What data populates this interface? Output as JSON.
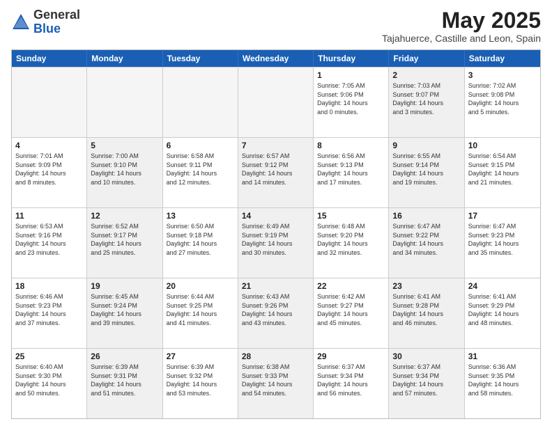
{
  "header": {
    "logo_general": "General",
    "logo_blue": "Blue",
    "month_year": "May 2025",
    "location": "Tajahuerce, Castille and Leon, Spain"
  },
  "days_of_week": [
    "Sunday",
    "Monday",
    "Tuesday",
    "Wednesday",
    "Thursday",
    "Friday",
    "Saturday"
  ],
  "weeks": [
    [
      {
        "day": "",
        "detail": "",
        "empty": true
      },
      {
        "day": "",
        "detail": "",
        "empty": true
      },
      {
        "day": "",
        "detail": "",
        "empty": true
      },
      {
        "day": "",
        "detail": "",
        "empty": true
      },
      {
        "day": "1",
        "detail": "Sunrise: 7:05 AM\nSunset: 9:06 PM\nDaylight: 14 hours\nand 0 minutes.",
        "shaded": false
      },
      {
        "day": "2",
        "detail": "Sunrise: 7:03 AM\nSunset: 9:07 PM\nDaylight: 14 hours\nand 3 minutes.",
        "shaded": true
      },
      {
        "day": "3",
        "detail": "Sunrise: 7:02 AM\nSunset: 9:08 PM\nDaylight: 14 hours\nand 5 minutes.",
        "shaded": false
      }
    ],
    [
      {
        "day": "4",
        "detail": "Sunrise: 7:01 AM\nSunset: 9:09 PM\nDaylight: 14 hours\nand 8 minutes.",
        "shaded": false
      },
      {
        "day": "5",
        "detail": "Sunrise: 7:00 AM\nSunset: 9:10 PM\nDaylight: 14 hours\nand 10 minutes.",
        "shaded": true
      },
      {
        "day": "6",
        "detail": "Sunrise: 6:58 AM\nSunset: 9:11 PM\nDaylight: 14 hours\nand 12 minutes.",
        "shaded": false
      },
      {
        "day": "7",
        "detail": "Sunrise: 6:57 AM\nSunset: 9:12 PM\nDaylight: 14 hours\nand 14 minutes.",
        "shaded": true
      },
      {
        "day": "8",
        "detail": "Sunrise: 6:56 AM\nSunset: 9:13 PM\nDaylight: 14 hours\nand 17 minutes.",
        "shaded": false
      },
      {
        "day": "9",
        "detail": "Sunrise: 6:55 AM\nSunset: 9:14 PM\nDaylight: 14 hours\nand 19 minutes.",
        "shaded": true
      },
      {
        "day": "10",
        "detail": "Sunrise: 6:54 AM\nSunset: 9:15 PM\nDaylight: 14 hours\nand 21 minutes.",
        "shaded": false
      }
    ],
    [
      {
        "day": "11",
        "detail": "Sunrise: 6:53 AM\nSunset: 9:16 PM\nDaylight: 14 hours\nand 23 minutes.",
        "shaded": false
      },
      {
        "day": "12",
        "detail": "Sunrise: 6:52 AM\nSunset: 9:17 PM\nDaylight: 14 hours\nand 25 minutes.",
        "shaded": true
      },
      {
        "day": "13",
        "detail": "Sunrise: 6:50 AM\nSunset: 9:18 PM\nDaylight: 14 hours\nand 27 minutes.",
        "shaded": false
      },
      {
        "day": "14",
        "detail": "Sunrise: 6:49 AM\nSunset: 9:19 PM\nDaylight: 14 hours\nand 30 minutes.",
        "shaded": true
      },
      {
        "day": "15",
        "detail": "Sunrise: 6:48 AM\nSunset: 9:20 PM\nDaylight: 14 hours\nand 32 minutes.",
        "shaded": false
      },
      {
        "day": "16",
        "detail": "Sunrise: 6:47 AM\nSunset: 9:22 PM\nDaylight: 14 hours\nand 34 minutes.",
        "shaded": true
      },
      {
        "day": "17",
        "detail": "Sunrise: 6:47 AM\nSunset: 9:23 PM\nDaylight: 14 hours\nand 35 minutes.",
        "shaded": false
      }
    ],
    [
      {
        "day": "18",
        "detail": "Sunrise: 6:46 AM\nSunset: 9:23 PM\nDaylight: 14 hours\nand 37 minutes.",
        "shaded": false
      },
      {
        "day": "19",
        "detail": "Sunrise: 6:45 AM\nSunset: 9:24 PM\nDaylight: 14 hours\nand 39 minutes.",
        "shaded": true
      },
      {
        "day": "20",
        "detail": "Sunrise: 6:44 AM\nSunset: 9:25 PM\nDaylight: 14 hours\nand 41 minutes.",
        "shaded": false
      },
      {
        "day": "21",
        "detail": "Sunrise: 6:43 AM\nSunset: 9:26 PM\nDaylight: 14 hours\nand 43 minutes.",
        "shaded": true
      },
      {
        "day": "22",
        "detail": "Sunrise: 6:42 AM\nSunset: 9:27 PM\nDaylight: 14 hours\nand 45 minutes.",
        "shaded": false
      },
      {
        "day": "23",
        "detail": "Sunrise: 6:41 AM\nSunset: 9:28 PM\nDaylight: 14 hours\nand 46 minutes.",
        "shaded": true
      },
      {
        "day": "24",
        "detail": "Sunrise: 6:41 AM\nSunset: 9:29 PM\nDaylight: 14 hours\nand 48 minutes.",
        "shaded": false
      }
    ],
    [
      {
        "day": "25",
        "detail": "Sunrise: 6:40 AM\nSunset: 9:30 PM\nDaylight: 14 hours\nand 50 minutes.",
        "shaded": false
      },
      {
        "day": "26",
        "detail": "Sunrise: 6:39 AM\nSunset: 9:31 PM\nDaylight: 14 hours\nand 51 minutes.",
        "shaded": true
      },
      {
        "day": "27",
        "detail": "Sunrise: 6:39 AM\nSunset: 9:32 PM\nDaylight: 14 hours\nand 53 minutes.",
        "shaded": false
      },
      {
        "day": "28",
        "detail": "Sunrise: 6:38 AM\nSunset: 9:33 PM\nDaylight: 14 hours\nand 54 minutes.",
        "shaded": true
      },
      {
        "day": "29",
        "detail": "Sunrise: 6:37 AM\nSunset: 9:34 PM\nDaylight: 14 hours\nand 56 minutes.",
        "shaded": false
      },
      {
        "day": "30",
        "detail": "Sunrise: 6:37 AM\nSunset: 9:34 PM\nDaylight: 14 hours\nand 57 minutes.",
        "shaded": true
      },
      {
        "day": "31",
        "detail": "Sunrise: 6:36 AM\nSunset: 9:35 PM\nDaylight: 14 hours\nand 58 minutes.",
        "shaded": false
      }
    ]
  ]
}
